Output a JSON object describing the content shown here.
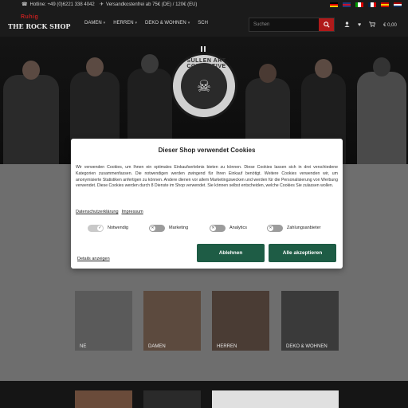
{
  "topbar": {
    "phone": "Hotline: +49 (0)6221 338 4042",
    "shipping": "Versandkostenfrei ab 75€ (DE) / 120€ (EU)"
  },
  "nav": {
    "logo_top": "Ruhig",
    "logo_main": "THE ROCK SHOP",
    "menu": [
      "DAMEN",
      "HERREN",
      "DEKO & WOHNEN",
      "SCH"
    ],
    "search_placeholder": "Suchen",
    "cart_value": "€ 0,00"
  },
  "hero": {
    "badge_text": "SULLEN ART COLLECTIVE"
  },
  "modal": {
    "title": "Dieser Shop verwendet Cookies",
    "body": "Wir verwenden Cookies, um Ihnen ein optimales Einkaufserlebnis bieten zu können. Diese Cookies lassen sich in drei verschiedene Kategorien zusammenfassen. Die notwendigen werden zwingend für Ihren Einkauf benötigt. Weitere Cookies verwenden wir, um anonymisierte Statistiken anfertigen zu können. Andere dienen vor allem Marketingzwecken und werden für die Personalisierung von Werbung verwendet. Diese Cookies werden durch 8 Dienste im Shop verwendet. Sie können selbst entscheiden, welche Cookies Sie zulassen wollen.",
    "link_privacy": "Datenschutzerklärung",
    "link_imprint": "Impressum",
    "toggles": [
      {
        "label": "Notwendig",
        "on": true
      },
      {
        "label": "Marketing",
        "on": false
      },
      {
        "label": "Analytics",
        "on": false
      },
      {
        "label": "Zahlungsanbieter",
        "on": false
      }
    ],
    "btn_reject": "Ablehnen",
    "btn_accept": "Alle akzeptieren",
    "details": "Details anzeigen"
  },
  "categories": [
    {
      "label": "NE"
    },
    {
      "label": "DAMEN"
    },
    {
      "label": "HERREN"
    },
    {
      "label": "DEKO & WOHNEN"
    }
  ],
  "colors": {
    "accent": "#b01a1a",
    "button": "#1e5c45"
  }
}
